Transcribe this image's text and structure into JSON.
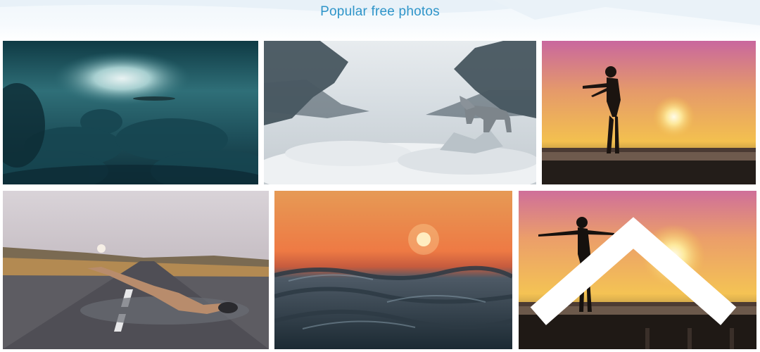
{
  "header": {
    "title": "Popular free photos"
  },
  "gallery": {
    "photos": [
      {
        "subject": "storm-clouds"
      },
      {
        "subject": "wolf-in-fog"
      },
      {
        "subject": "woman-sunset-silhouette"
      },
      {
        "subject": "swimmer-on-road"
      },
      {
        "subject": "sea-sunset"
      },
      {
        "subject": "woman-sunset-pier"
      }
    ]
  },
  "icons": {
    "corner": "chevron-up-icon"
  }
}
